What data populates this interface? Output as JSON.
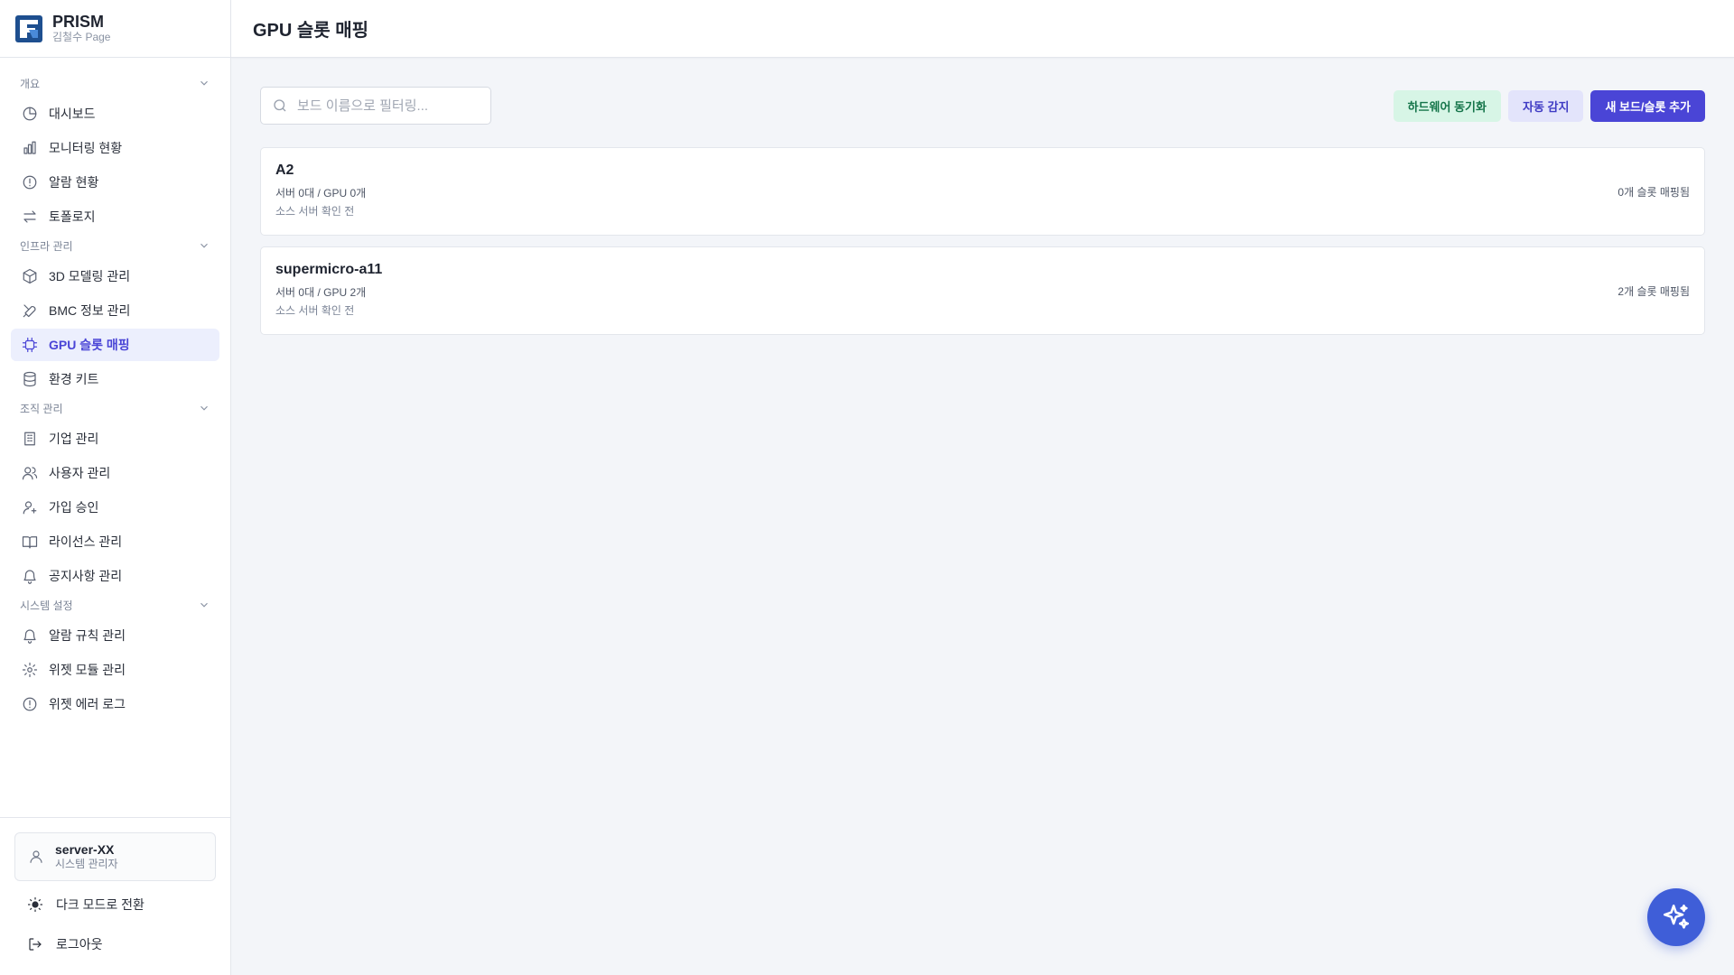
{
  "brand": {
    "name": "PRISM",
    "subtitle": "김철수 Page"
  },
  "page": {
    "title": "GPU 슬롯 매핑"
  },
  "sidebar": {
    "sections": [
      {
        "label": "개요",
        "items": [
          {
            "label": "대시보드",
            "icon": "pie-chart-icon"
          },
          {
            "label": "모니터링 현황",
            "icon": "bar-chart-icon"
          },
          {
            "label": "알람 현황",
            "icon": "alert-circle-icon"
          },
          {
            "label": "토폴로지",
            "icon": "arrows-swap-icon"
          }
        ]
      },
      {
        "label": "인프라 관리",
        "items": [
          {
            "label": "3D 모델링 관리",
            "icon": "cube-icon"
          },
          {
            "label": "BMC 정보 관리",
            "icon": "tools-icon"
          },
          {
            "label": "GPU 슬롯 매핑",
            "icon": "chip-icon",
            "active": true
          },
          {
            "label": "환경 키트",
            "icon": "database-icon"
          }
        ]
      },
      {
        "label": "조직 관리",
        "items": [
          {
            "label": "기업 관리",
            "icon": "building-icon"
          },
          {
            "label": "사용자 관리",
            "icon": "users-icon"
          },
          {
            "label": "가입 승인",
            "icon": "user-plus-icon"
          },
          {
            "label": "라이선스 관리",
            "icon": "book-icon"
          },
          {
            "label": "공지사항 관리",
            "icon": "bell-icon"
          }
        ]
      },
      {
        "label": "시스템 설정",
        "items": [
          {
            "label": "알람 규칙 관리",
            "icon": "bell-icon"
          },
          {
            "label": "위젯 모듈 관리",
            "icon": "gear-icon"
          },
          {
            "label": "위젯 에러 로그",
            "icon": "alert-circle-icon"
          }
        ]
      }
    ],
    "user": {
      "name": "server-XX",
      "role": "시스템 관리자"
    },
    "dark_mode_label": "다크 모드로 전환",
    "logout_label": "로그아웃"
  },
  "search": {
    "placeholder": "보드 이름으로 필터링..."
  },
  "toolbar": {
    "sync_label": "하드웨어 동기화",
    "detect_label": "자동 감지",
    "add_label": "새 보드/슬롯 추가"
  },
  "boards": [
    {
      "name": "A2",
      "meta": "서버 0대 / GPU 0개",
      "source": "소스 서버 확인 전",
      "mapped": "0개 슬롯 매핑됨"
    },
    {
      "name": "supermicro-a11",
      "meta": "서버 0대 / GPU 2개",
      "source": "소스 서버 확인 전",
      "mapped": "2개 슬롯 매핑됨"
    }
  ],
  "colors": {
    "accent": "#4a45d6",
    "fab": "#3f5ed8",
    "sync_bg": "#d7f5e6",
    "detect_bg": "#e3e4fb"
  }
}
